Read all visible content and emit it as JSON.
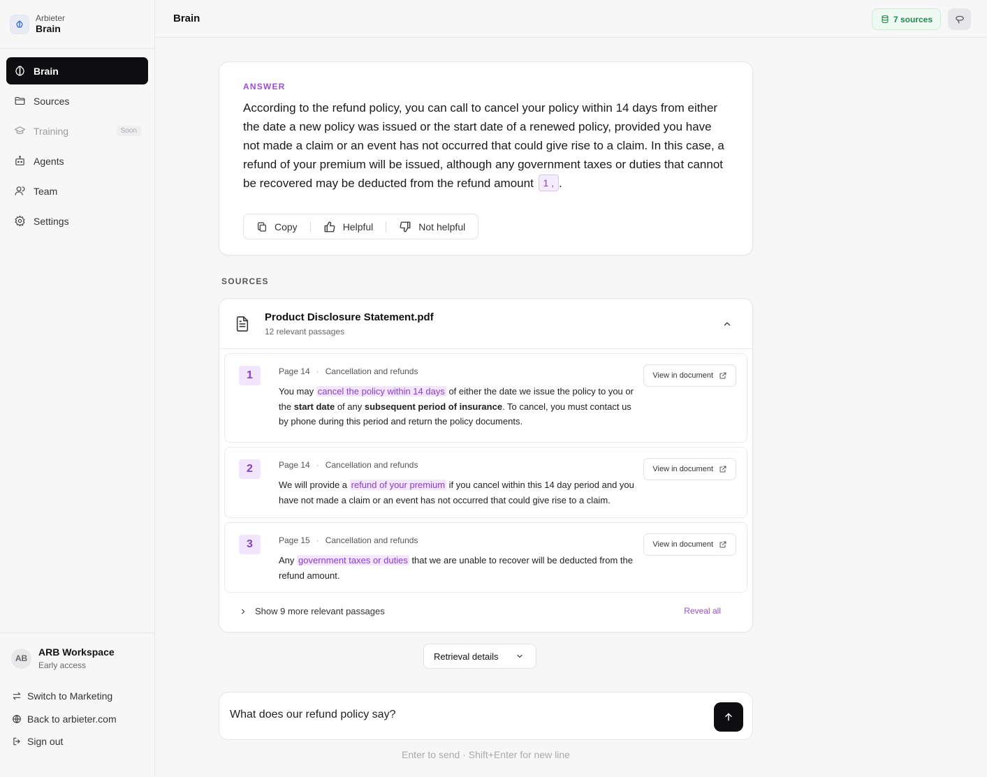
{
  "sidebar": {
    "brand_sub": "Arbieter",
    "brand_name": "Brain",
    "nav": [
      {
        "label": "Brain",
        "icon": "brain-icon",
        "active": true
      },
      {
        "label": "Sources",
        "icon": "folder-icon"
      },
      {
        "label": "Training",
        "icon": "graduation-cap-icon",
        "badge": "Soon",
        "disabled": true
      },
      {
        "label": "Agents",
        "icon": "robot-icon"
      },
      {
        "label": "Team",
        "icon": "user-icon"
      },
      {
        "label": "Settings",
        "icon": "gear-icon"
      }
    ],
    "workspace": {
      "initials": "AB",
      "name": "ARB Workspace",
      "status": "Early access"
    },
    "links": [
      {
        "label": "Switch to Marketing",
        "icon": "switch-arrows-icon"
      },
      {
        "label": "Back to arbieter.com",
        "icon": "globe-icon"
      },
      {
        "label": "Sign out",
        "icon": "sign-out-icon"
      }
    ]
  },
  "header": {
    "title": "Brain",
    "sources_badge": "7 sources",
    "action_icon": "lasso-icon"
  },
  "answer": {
    "label": "ANSWER",
    "text": "According to the refund policy, you can call to cancel your policy within 14 days from either the date a new policy was issued or the start date of a renewed policy, provided you have not made a claim or an event has not occurred that could give rise to a claim. In this case, a refund of your premium will be issued, although any government taxes or duties that cannot be recovered may be deducted from the refund amount",
    "citation": "1 ,",
    "end_punct": ".",
    "actions": {
      "copy": "Copy",
      "helpful": "Helpful",
      "not_helpful": "Not helpful"
    }
  },
  "sources": {
    "label": "SOURCES",
    "document": {
      "title": "Product Disclosure Statement.pdf",
      "subtitle": "12 relevant passages"
    },
    "passages": [
      {
        "num": "1",
        "page": "Page 14",
        "section": "Cancellation and refunds",
        "pre": "You may ",
        "hl": "cancel the policy within 14 days",
        "mid": " of either the date we issue the policy to you or the ",
        "b1": "start date",
        "mid2": " of any ",
        "b2": "subsequent period of insurance",
        "post": ". To cancel, you must contact us by phone during this period and return the policy documents."
      },
      {
        "num": "2",
        "page": "Page 14",
        "section": "Cancellation and refunds",
        "pre": "We will provide a ",
        "hl": "refund of your premium",
        "post": " if you cancel within this 14 day period and you have not made a claim or an event has not occurred that could give rise to a claim."
      },
      {
        "num": "3",
        "page": "Page 15",
        "section": "Cancellation and refunds",
        "pre": "Any ",
        "hl": "government taxes or duties",
        "post": " that we are unable to recover will be deducted from the refund amount."
      }
    ],
    "view_label": "View in document",
    "show_more": "Show 9 more relevant passages",
    "reveal_all": "Reveal all"
  },
  "retrieval": {
    "label": "Retrieval details"
  },
  "composer": {
    "value": "What does our refund policy say?",
    "hint": "Enter to send · Shift+Enter for new line"
  }
}
